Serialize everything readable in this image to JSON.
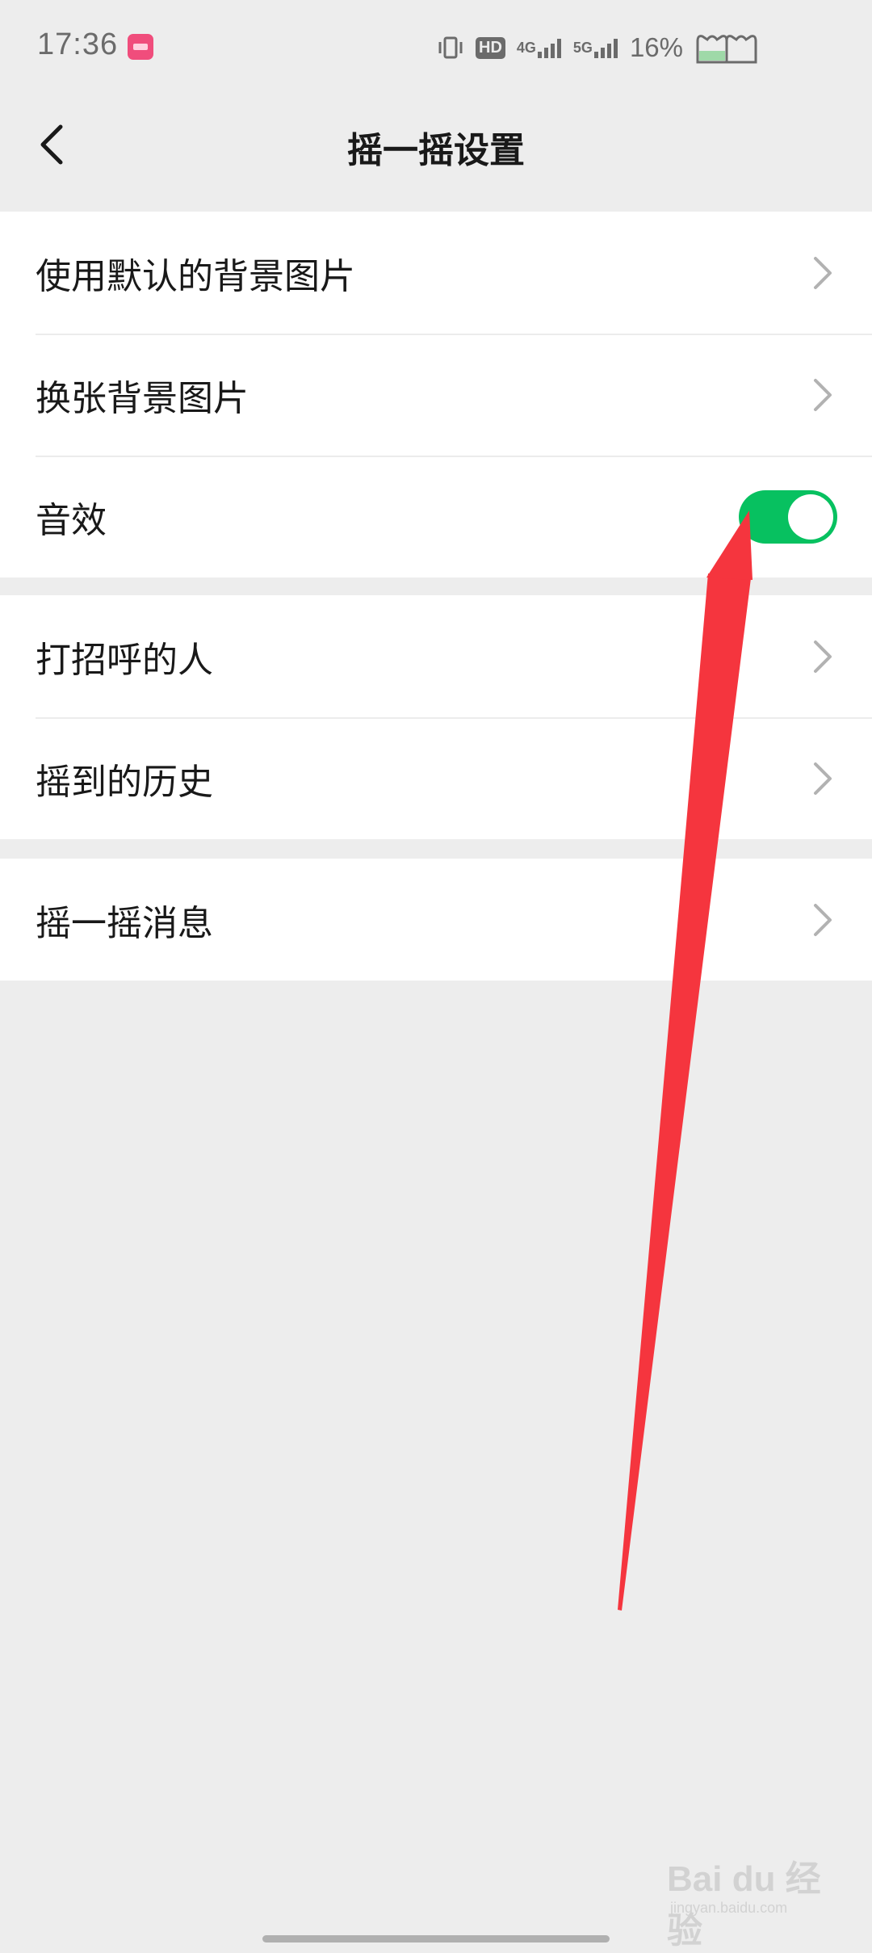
{
  "status_bar": {
    "time": "17:36",
    "hd_label": "HD",
    "network_1": "4G",
    "network_2": "5G",
    "battery": "16%",
    "icons": [
      "app-notification-icon",
      "vibrate-icon",
      "hd-icon",
      "signal-4g-icon",
      "signal-5g-icon",
      "battery-icon"
    ]
  },
  "nav": {
    "back_icon": "chevron-left-icon",
    "title": "摇一摇设置"
  },
  "groups": [
    {
      "items": [
        {
          "label": "使用默认的背景图片",
          "control": "chevron"
        },
        {
          "label": "换张背景图片",
          "control": "chevron"
        },
        {
          "label": "音效",
          "control": "toggle",
          "toggle_on": true
        }
      ]
    },
    {
      "items": [
        {
          "label": "打招呼的人",
          "control": "chevron"
        },
        {
          "label": "摇到的历史",
          "control": "chevron"
        }
      ]
    },
    {
      "items": [
        {
          "label": "摇一摇消息",
          "control": "chevron"
        }
      ]
    }
  ],
  "colors": {
    "background": "#ededed",
    "cell_background": "#ffffff",
    "toggle_on": "#07c160",
    "annotation_arrow": "#f5353e",
    "text_primary": "#191919",
    "chevron": "#b2b2b2"
  },
  "watermark": {
    "brand": "Bai du 经验",
    "sub": "jingyan.baidu.com"
  }
}
